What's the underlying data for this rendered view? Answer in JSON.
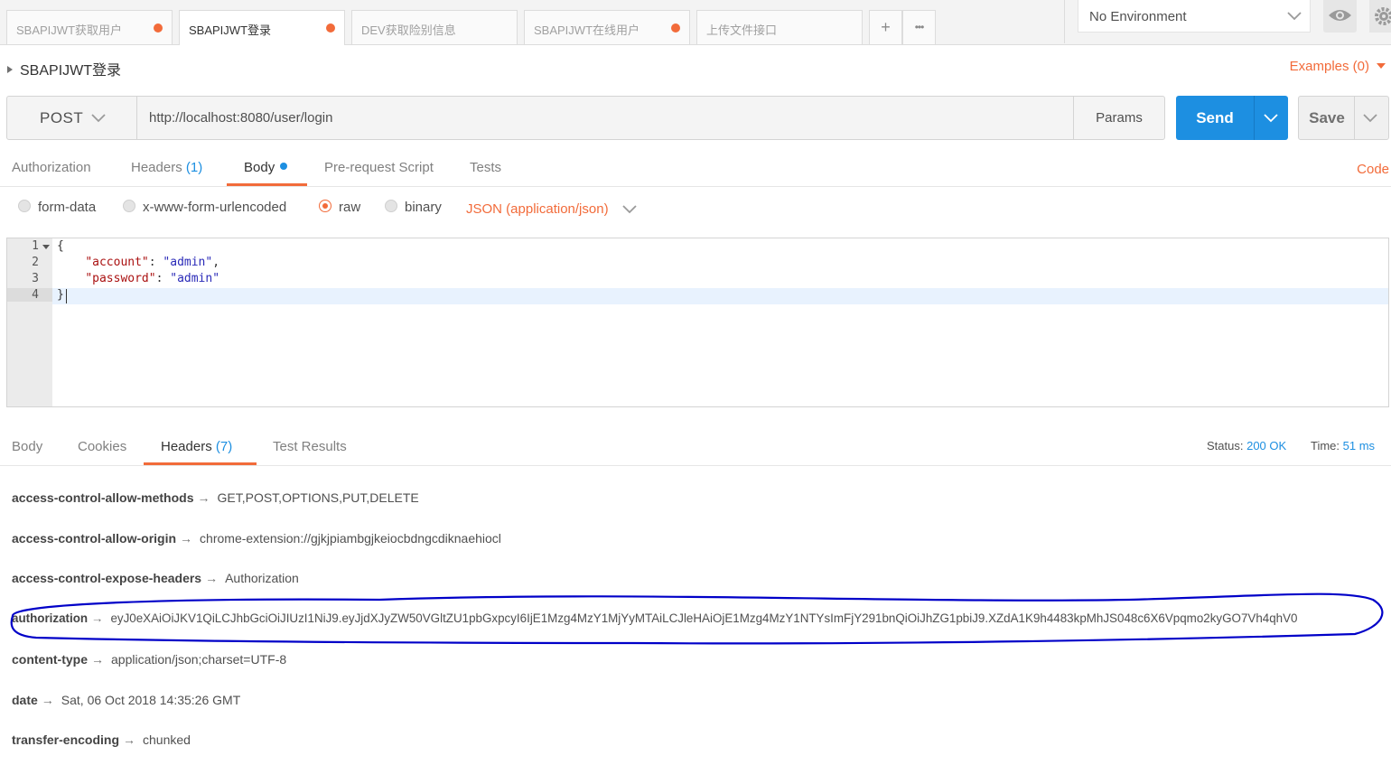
{
  "tabs": [
    {
      "label": "SBAPIJWT获取用户",
      "unsaved": true
    },
    {
      "label": "SBAPIJWT登录",
      "unsaved": true,
      "active": true
    },
    {
      "label": "DEV获取险别信息",
      "unsaved": false
    },
    {
      "label": "SBAPIJWT在线用户",
      "unsaved": true
    },
    {
      "label": "上传文件接口",
      "unsaved": false
    }
  ],
  "tab_actions": {
    "add": "+",
    "more": "•••"
  },
  "environment": {
    "selected": "No Environment"
  },
  "request": {
    "name": "SBAPIJWT登录",
    "examples": "Examples (0)",
    "method": "POST",
    "url": "http://localhost:8080/user/login",
    "params_label": "Params",
    "send_label": "Send",
    "save_label": "Save"
  },
  "request_tabs": {
    "authorization": "Authorization",
    "headers": "Headers",
    "headers_count": "(1)",
    "body": "Body",
    "prerequest": "Pre-request Script",
    "tests": "Tests",
    "code": "Code"
  },
  "body_types": {
    "form_data": "form-data",
    "urlencoded": "x-www-form-urlencoded",
    "raw": "raw",
    "binary": "binary",
    "selected": "raw",
    "content_type": "JSON (application/json)"
  },
  "editor": {
    "line_numbers": [
      "1",
      "2",
      "3",
      "4"
    ],
    "lines": {
      "l1": "{",
      "l2_key": "\"account\"",
      "l2_sep": ": ",
      "l2_val": "\"admin\"",
      "l2_end": ",",
      "l3_key": "\"password\"",
      "l3_sep": ": ",
      "l3_val": "\"admin\"",
      "l4": "}"
    }
  },
  "response_tabs": {
    "body": "Body",
    "cookies": "Cookies",
    "headers": "Headers",
    "headers_count": "(7)",
    "test_results": "Test Results"
  },
  "response_status": {
    "status_label": "Status:",
    "status_value": "200 OK",
    "time_label": "Time:",
    "time_value": "51 ms"
  },
  "response_headers": [
    {
      "key": "access-control-allow-methods",
      "value": "GET,POST,OPTIONS,PUT,DELETE"
    },
    {
      "key": "access-control-allow-origin",
      "value": "chrome-extension://gjkjpiambgjkeiocbdngcdiknaehiocl"
    },
    {
      "key": "access-control-expose-headers",
      "value": "Authorization"
    },
    {
      "key": "authorization",
      "value": "eyJ0eXAiOiJKV1QiLCJhbGciOiJIUzI1NiJ9.eyJjdXJyZW50VGltZU1pbGxpcyI6IjE1Mzg4MzY1MjYyMTAiLCJleHAiOjE1Mzg4MzY1NTYsImFjY291bnQiOiJhZG1pbiJ9.XZdA1K9h4483kpMhJS048c6X6Vpqmo2kyGO7Vh4qhV0"
    },
    {
      "key": "content-type",
      "value": "application/json;charset=UTF-8"
    },
    {
      "key": "date",
      "value": "Sat, 06 Oct 2018 14:35:26 GMT"
    },
    {
      "key": "transfer-encoding",
      "value": "chunked"
    }
  ],
  "arrow_glyph": "→",
  "colors": {
    "accent": "#f26b3a",
    "send": "#1d8fe1",
    "annotation": "#0000c8"
  }
}
